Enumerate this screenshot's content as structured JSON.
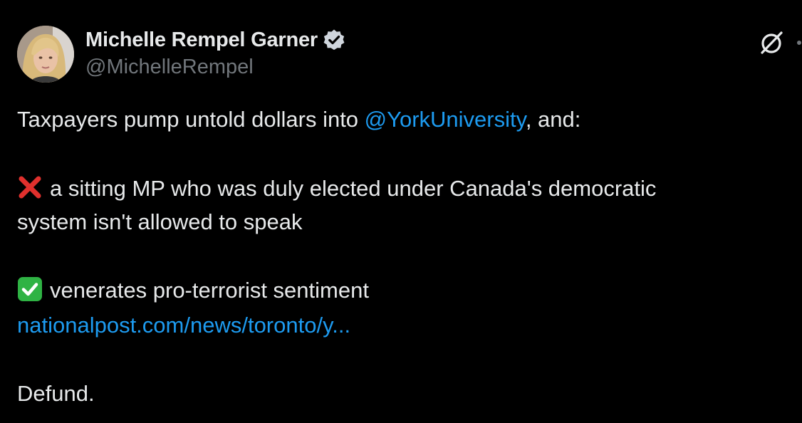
{
  "author": {
    "name": "Michelle Rempel Garner",
    "handle": "@MichelleRempel",
    "verified_icon": "verified-badge-icon"
  },
  "actions": {
    "grok_icon": "grok-icon",
    "more_icon": "more-icon"
  },
  "tweet": {
    "line1_before": "Taxpayers pump untold dollars into ",
    "mention": "@YorkUniversity",
    "line1_after": ", and:",
    "cross_text_line1": "a sitting MP who was duly elected under Canada's democratic",
    "cross_text_line2": "system isn't allowed to speak",
    "check_text": "venerates pro-terrorist sentiment",
    "link": "nationalpost.com/news/toronto/y...",
    "closing": "Defund."
  },
  "colors": {
    "background": "#000000",
    "text": "#e7e9ea",
    "secondary": "#71767b",
    "accent": "#1d9bf0",
    "cross": "#e0302d",
    "check": "#2fb344"
  }
}
